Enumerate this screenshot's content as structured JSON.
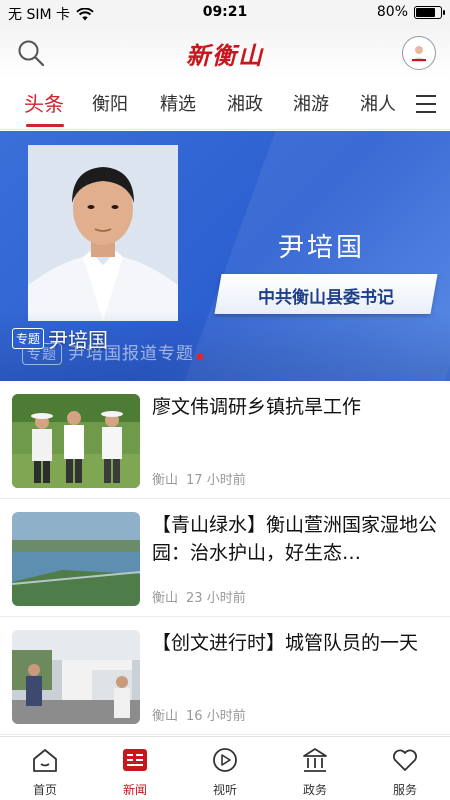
{
  "status_bar": {
    "carrier": "无 SIM 卡",
    "time": "09:21",
    "battery": "80%",
    "battery_level": 0.8
  },
  "header": {
    "logo": "新衡山"
  },
  "tabs": [
    {
      "label": "头条",
      "active": true
    },
    {
      "label": "衡阳"
    },
    {
      "label": "精选"
    },
    {
      "label": "湘政"
    },
    {
      "label": "湘游"
    },
    {
      "label": "湘人"
    }
  ],
  "banner": {
    "name": "尹培国",
    "position_title": "中共衡山县委书记",
    "subtitle_tag": "专题",
    "subtitle": "尹培国报道专题",
    "caption_tag": "专题",
    "caption": "尹培国"
  },
  "news": [
    {
      "title": "廖文伟调研乡镇抗旱工作",
      "source": "衡山",
      "time": "17 小时前"
    },
    {
      "title": "【青山绿水】衡山萱洲国家湿地公园：治水护山，好生态…",
      "source": "衡山",
      "time": "23 小时前"
    },
    {
      "title": "【创文进行时】城管队员的一天",
      "source": "衡山",
      "time": "16 小时前"
    }
  ],
  "bottom_nav": [
    {
      "label": "首页",
      "icon": "home-icon"
    },
    {
      "label": "新闻",
      "icon": "news-icon",
      "active": true
    },
    {
      "label": "视听",
      "icon": "play-icon"
    },
    {
      "label": "政务",
      "icon": "government-icon"
    },
    {
      "label": "服务",
      "icon": "heart-icon"
    }
  ],
  "colors": {
    "brand_red": "#c8161d",
    "banner_blue": "#2c5fd0"
  }
}
